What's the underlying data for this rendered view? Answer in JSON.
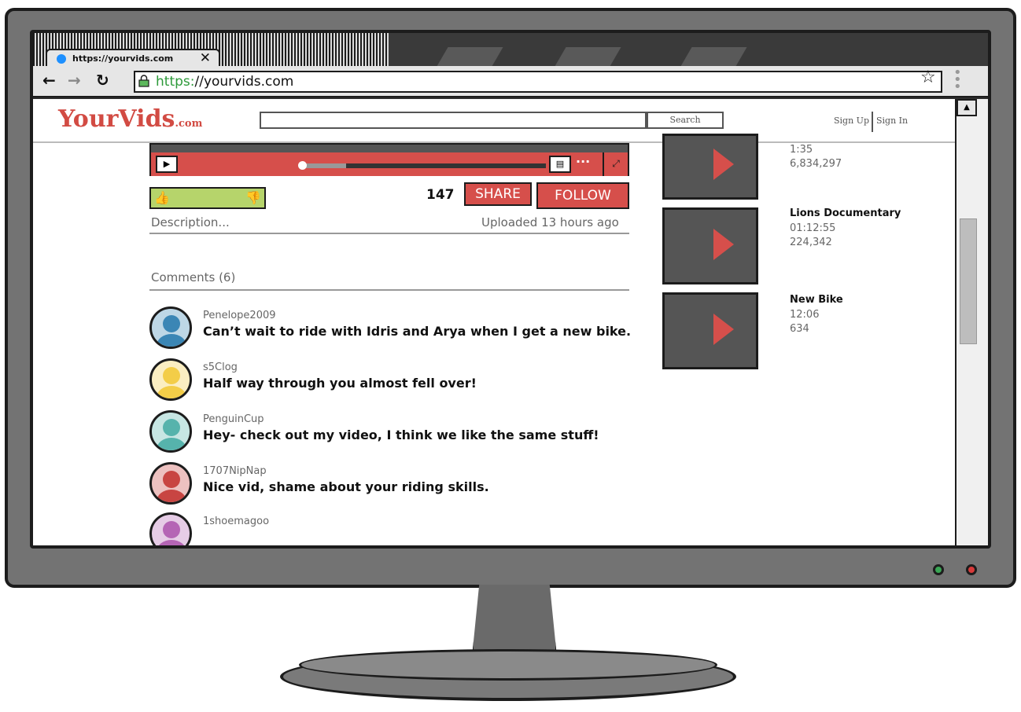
{
  "browser": {
    "tab_title": "https://yourvids.com",
    "tab_close": "✕",
    "url_scheme": "https:",
    "url_rest": "//yourvids.com",
    "icons": [
      "back-arrow-icon",
      "forward-arrow-icon",
      "reload-icon",
      "lock-icon",
      "star-icon",
      "kebab-menu-icon"
    ]
  },
  "site": {
    "logo_main": "YourVids",
    "logo_suffix": ".com",
    "search_label": "Search",
    "sign_up": "Sign Up",
    "sign_in": "Sign In"
  },
  "video": {
    "progress_fraction": 0.33,
    "likes": "147",
    "share_label": "SHARE",
    "follow_label": "FOLLOW",
    "description": "Description...",
    "uploaded": "Uploaded 13 hours ago"
  },
  "comments": {
    "title": "Comments (6)",
    "items": [
      {
        "user": "Penelope2009",
        "text": "Can’t wait to ride with Idris and Arya when I get a new bike.",
        "color": "#3b86b5"
      },
      {
        "user": "s5Clog",
        "text": "Half way through you almost fell over!",
        "color": "#f3cd48"
      },
      {
        "user": "PenguinCup",
        "text": "Hey- check out my video, I think we like the same stuff!",
        "color": "#56b3ac"
      },
      {
        "user": "1707NipNap",
        "text": "Nice vid, shame about your riding skills.",
        "color": "#c84542"
      },
      {
        "user": "1shoemagoo",
        "text": "",
        "color": "#b565b5"
      }
    ]
  },
  "related": [
    {
      "title": "",
      "duration": "1:35",
      "views": "6,834,297"
    },
    {
      "title": "Lions Documentary",
      "duration": "01:12:55",
      "views": "224,342"
    },
    {
      "title": "New Bike",
      "duration": "12:06",
      "views": "634"
    }
  ],
  "colors": {
    "accent": "#d64f4b",
    "rating_bar": "#b6d46b",
    "monitor": "#737373"
  }
}
